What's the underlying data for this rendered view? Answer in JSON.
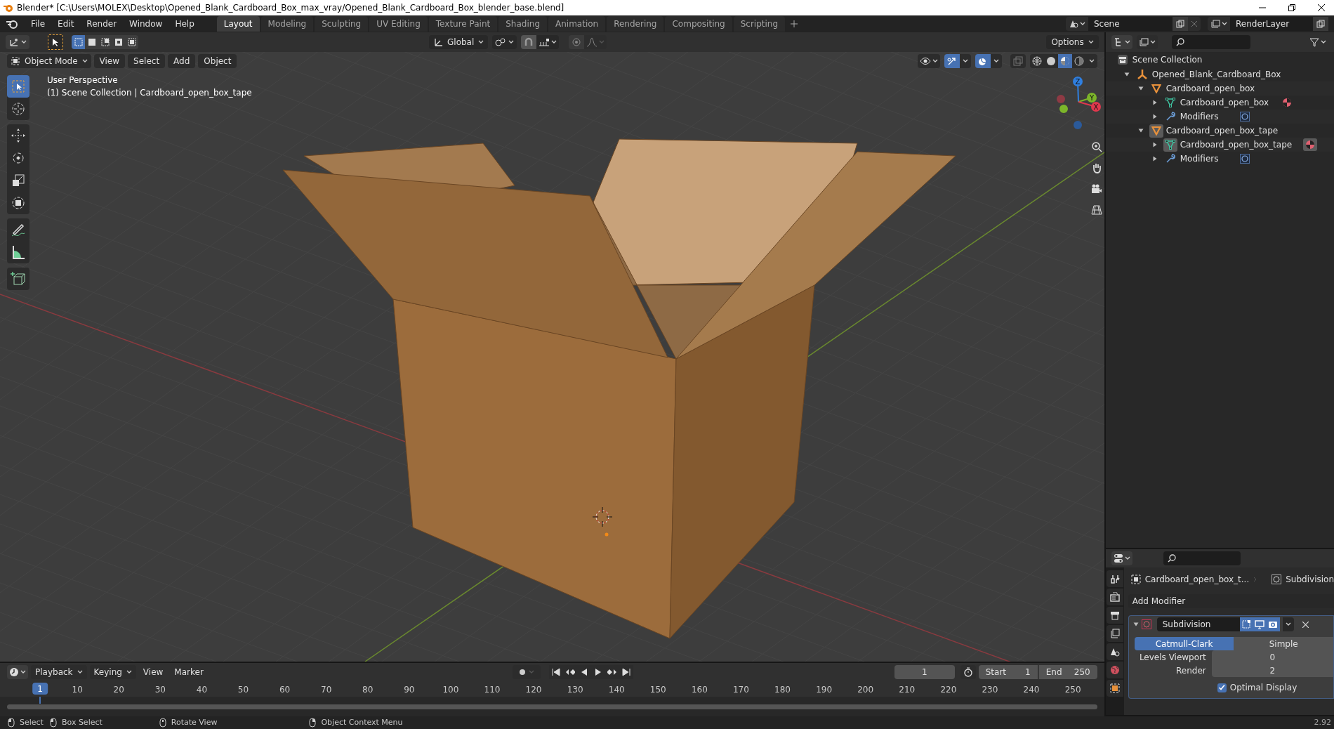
{
  "window": {
    "title": "Blender* [C:\\Users\\MOLEX\\Desktop\\Opened_Blank_Cardboard_Box_max_vray/Opened_Blank_Cardboard_Box_blender_base.blend]"
  },
  "menu": [
    "File",
    "Edit",
    "Render",
    "Window",
    "Help"
  ],
  "workspaces": [
    {
      "label": "Layout",
      "selected": true
    },
    {
      "label": "Modeling",
      "selected": false
    },
    {
      "label": "Sculpting",
      "selected": false
    },
    {
      "label": "UV Editing",
      "selected": false
    },
    {
      "label": "Texture Paint",
      "selected": false
    },
    {
      "label": "Shading",
      "selected": false
    },
    {
      "label": "Animation",
      "selected": false
    },
    {
      "label": "Rendering",
      "selected": false
    },
    {
      "label": "Compositing",
      "selected": false
    },
    {
      "label": "Scripting",
      "selected": false
    }
  ],
  "scene": {
    "value": "Scene"
  },
  "view_layer": {
    "value": "RenderLayer"
  },
  "tool_header": {
    "select_modes": [
      {
        "kind": "new",
        "selected": true
      },
      {
        "kind": "extend",
        "selected": false
      },
      {
        "kind": "subtract",
        "selected": false
      },
      {
        "kind": "invert",
        "selected": false
      },
      {
        "kind": "intersect",
        "selected": false
      }
    ],
    "orientation": "Global",
    "options": "Options"
  },
  "viewport_header": {
    "mode": "Object Mode",
    "menus": [
      "View",
      "Select",
      "Add",
      "Object"
    ],
    "shading": [
      {
        "kind": "wireframe",
        "selected": false
      },
      {
        "kind": "solid",
        "selected": false
      },
      {
        "kind": "material",
        "selected": true
      },
      {
        "kind": "rendered",
        "selected": false
      }
    ]
  },
  "viewport": {
    "perspective": "User Perspective",
    "collection": "(1) Scene Collection | Cardboard_open_box_tape",
    "gizmo": {
      "x": "X",
      "y": "Y",
      "z": "Z"
    }
  },
  "toolbar": [
    {
      "kind": "select",
      "selected": true
    },
    {
      "kind": "cursor",
      "selected": false
    },
    {
      "kind": "move",
      "selected": false
    },
    {
      "kind": "rotate",
      "selected": false
    },
    {
      "kind": "scale",
      "selected": false
    },
    {
      "kind": "transform",
      "selected": false
    },
    {
      "kind": "annotate",
      "selected": false
    },
    {
      "kind": "measure",
      "selected": false
    },
    {
      "kind": "add-cube",
      "selected": false
    }
  ],
  "outliner": {
    "root": "Scene Collection",
    "tree": [
      {
        "label": "Opened_Blank_Cardboard_Box",
        "kind": "empty",
        "expanded": true,
        "selected": false,
        "children": [
          {
            "label": "Cardboard_open_box",
            "kind": "object",
            "expanded": true,
            "selected": false,
            "children": [
              {
                "label": "Cardboard_open_box",
                "kind": "mesh",
                "expanded": false,
                "selected": false
              },
              {
                "label": "Modifiers",
                "kind": "modifiers",
                "expanded": false,
                "selected": false
              }
            ]
          },
          {
            "label": "Cardboard_open_box_tape",
            "kind": "object",
            "expanded": true,
            "selected": true,
            "children": [
              {
                "label": "Cardboard_open_box_tape",
                "kind": "mesh",
                "expanded": false,
                "selected": true
              },
              {
                "label": "Modifiers",
                "kind": "modifiers",
                "expanded": false,
                "selected": false
              }
            ]
          }
        ]
      }
    ]
  },
  "properties": {
    "tabs": [
      {
        "kind": "tool"
      },
      {
        "kind": "render"
      },
      {
        "kind": "output"
      },
      {
        "kind": "view-layer"
      },
      {
        "kind": "scene"
      },
      {
        "kind": "world"
      },
      {
        "kind": "object"
      }
    ],
    "breadcrumb": [
      "Cardboard_open_box_t...",
      "Subdivision"
    ],
    "add_modifier": "Add Modifier",
    "modifier": {
      "name": "Subdivision",
      "expanded": true,
      "toggles": [
        {
          "kind": "edit-mode",
          "on": true
        },
        {
          "kind": "viewport",
          "on": true
        },
        {
          "kind": "render",
          "on": true
        }
      ],
      "algorithms": [
        {
          "label": "Catmull-Clark",
          "selected": true
        },
        {
          "label": "Simple",
          "selected": false
        }
      ],
      "fields": [
        {
          "label": "Levels Viewport",
          "value": "0"
        },
        {
          "label": "Render",
          "value": "2"
        }
      ],
      "optimal_display": {
        "label": "Optimal Display",
        "checked": true
      }
    }
  },
  "timeline": {
    "menus": [
      "Playback",
      "Keying",
      "View",
      "Marker"
    ],
    "current_frame": "1",
    "start_label": "Start",
    "start": "1",
    "end_label": "End",
    "end": "250",
    "playhead": "1",
    "ruler": [
      "10",
      "20",
      "30",
      "40",
      "50",
      "60",
      "70",
      "80",
      "90",
      "100",
      "110",
      "120",
      "130",
      "140",
      "150",
      "160",
      "170",
      "180",
      "190",
      "200",
      "210",
      "220",
      "230",
      "240",
      "250"
    ]
  },
  "status_bar": {
    "hints": [
      {
        "kind": "mouse-left",
        "label": "Select"
      },
      {
        "kind": "mouse-drag",
        "label": "Box Select"
      },
      {
        "kind": "mouse-middle",
        "label": "Rotate View"
      },
      {
        "kind": "mouse-right",
        "label": "Object Context Menu"
      }
    ],
    "version": "2.92"
  }
}
